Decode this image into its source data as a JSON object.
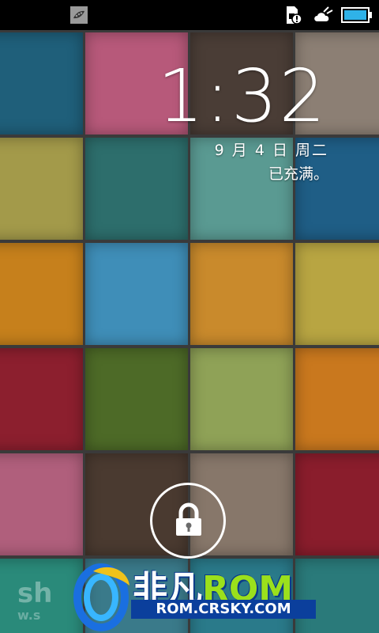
{
  "status_bar": {
    "icons": [
      "notification-app-icon",
      "sim-alert-icon",
      "weather-icon",
      "battery-icon"
    ],
    "battery_color": "#2fb2e8"
  },
  "lockscreen": {
    "time": "1:32",
    "date": "9 月 4 日 周二",
    "charging_status": "已充满。",
    "unlock_icon": "padlock-icon"
  },
  "wallpaper": {
    "tile_colors": [
      [
        "#1f5f7a",
        "#b7597a",
        "#4a3d36",
        "#8c7f74"
      ],
      [
        "#a39a4a",
        "#2d6e6c",
        "#5a9a92",
        "#1f5e86"
      ],
      [
        "#c6801c",
        "#3f8eb8",
        "#c98a2c",
        "#b8a542"
      ],
      [
        "#8c1f2e",
        "#4d6a27",
        "#8fa257",
        "#c9781e"
      ],
      [
        "#b05f7c",
        "#4a3a30",
        "#87776a",
        "#8a1d2c"
      ],
      [
        "#2a8a7a",
        "#3a7a8a",
        "#2a7a8a",
        "#2a7a7a"
      ]
    ]
  },
  "watermark": {
    "left_text": "sh",
    "left_sub": "w.s",
    "brand_cn": "非凡",
    "brand_rom": "ROM",
    "url": "ROM.CRSKY.COM"
  }
}
